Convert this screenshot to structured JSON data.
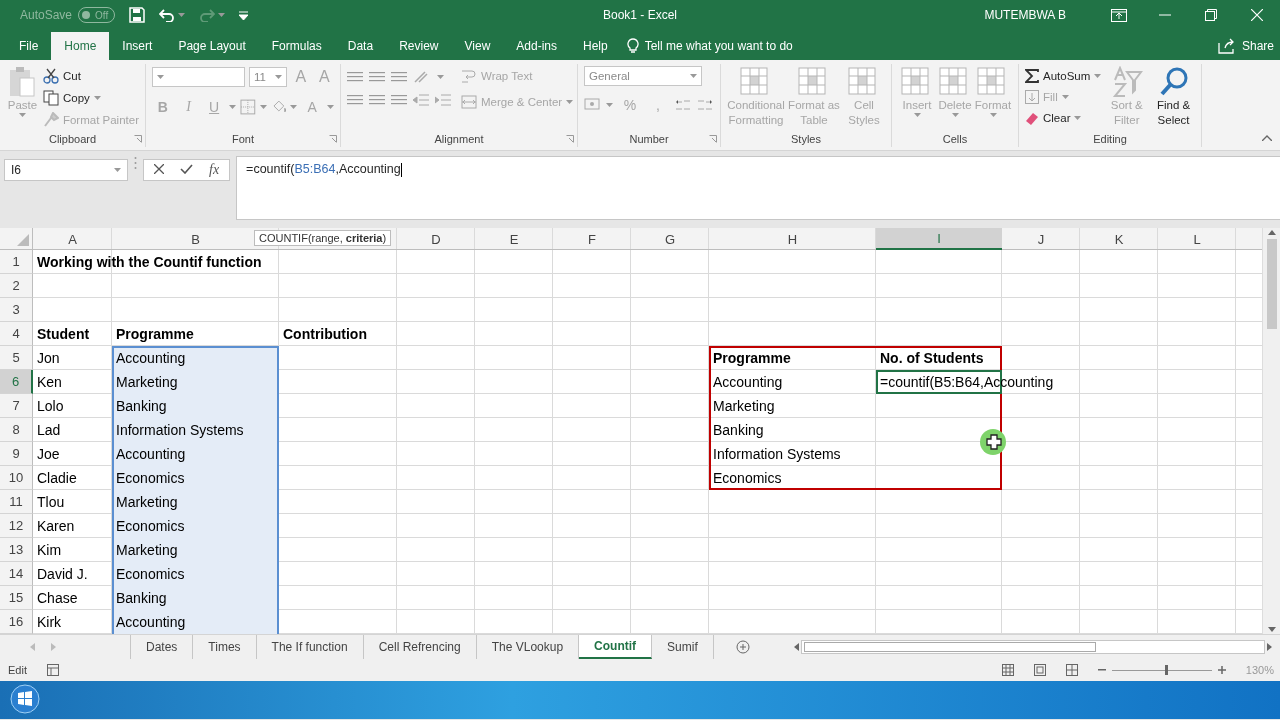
{
  "title_bar": {
    "autosave": {
      "label": "AutoSave",
      "toggle": "Off",
      "on": false
    },
    "title": "Book1  -  Excel",
    "user": "MUTEMBWA B"
  },
  "tabs": [
    {
      "label": "File",
      "selected": false
    },
    {
      "label": "Home",
      "selected": true
    },
    {
      "label": "Insert",
      "selected": false
    },
    {
      "label": "Page Layout",
      "selected": false
    },
    {
      "label": "Formulas",
      "selected": false
    },
    {
      "label": "Data",
      "selected": false
    },
    {
      "label": "Review",
      "selected": false
    },
    {
      "label": "View",
      "selected": false
    },
    {
      "label": "Add-ins",
      "selected": false
    },
    {
      "label": "Help",
      "selected": false
    }
  ],
  "tell_me": "Tell me what you want to do",
  "share": "Share",
  "ribbon": {
    "clipboard": {
      "label": "Clipboard",
      "paste": {
        "label": "Paste",
        "disabled": true
      },
      "cut": {
        "label": "Cut",
        "disabled": false
      },
      "copy": {
        "label": "Copy",
        "disabled": false
      },
      "format_painter": {
        "label": "Format Painter",
        "disabled": true
      }
    },
    "font": {
      "label": "Font",
      "size": "11",
      "buttons": [
        {
          "label": "A",
          "kind": "grow"
        },
        {
          "label": "A",
          "kind": "shrink"
        },
        {
          "label": "B",
          "kind": "bold"
        },
        {
          "label": "I",
          "kind": "italic"
        },
        {
          "label": "U",
          "kind": "underline"
        },
        {
          "label": "A",
          "kind": "color"
        }
      ]
    },
    "alignment": {
      "label": "Alignment",
      "wrap_text": {
        "label": "Wrap Text",
        "disabled": true
      },
      "merge": {
        "label": "Merge & Center",
        "disabled": true
      }
    },
    "number": {
      "label": "Number",
      "format": "General",
      "symbols": [
        "%",
        ","
      ]
    },
    "styles": {
      "label": "Styles",
      "buttons": [
        {
          "label": "Conditional Formatting",
          "disabled": true
        },
        {
          "label": "Format as Table",
          "disabled": true
        },
        {
          "label": "Cell Styles",
          "disabled": true
        }
      ]
    },
    "cells": {
      "label": "Cells",
      "buttons": [
        {
          "label": "Insert",
          "disabled": true
        },
        {
          "label": "Delete",
          "disabled": true
        },
        {
          "label": "Format",
          "disabled": true
        }
      ]
    },
    "editing": {
      "label": "Editing",
      "small": [
        {
          "label": "AutoSum",
          "disabled": false
        },
        {
          "label": "Fill",
          "disabled": true
        },
        {
          "label": "Clear",
          "disabled": false
        }
      ],
      "big": [
        {
          "label": "Sort & Filter",
          "disabled": true
        },
        {
          "label": "Find & Select",
          "disabled": false
        }
      ]
    }
  },
  "formula_bar": {
    "name_box": "I6",
    "fx": "fx",
    "formula": {
      "start": "=countif(",
      "reference": "B5:B64",
      "end": ",Accounting"
    }
  },
  "sheet": {
    "columns": [
      {
        "label": "A",
        "selected": false
      },
      {
        "label": "B",
        "selected": false
      },
      {
        "selected": false
      },
      {
        "label": "D",
        "selected": false
      },
      {
        "label": "E",
        "selected": false
      },
      {
        "label": "F",
        "selected": false
      },
      {
        "label": "G",
        "selected": false
      },
      {
        "label": "H",
        "selected": false
      },
      {
        "label": "I",
        "selected": true
      },
      {
        "label": "J",
        "selected": false
      },
      {
        "label": "K",
        "selected": false
      },
      {
        "label": "L",
        "selected": false
      }
    ],
    "rows": [
      {
        "label": "1",
        "selected": false
      },
      {
        "label": "2",
        "selected": false
      },
      {
        "label": "3",
        "selected": false
      },
      {
        "label": "4",
        "selected": false
      },
      {
        "label": "5",
        "selected": false
      },
      {
        "label": "6",
        "selected": true
      },
      {
        "label": "7",
        "selected": false
      },
      {
        "label": "8",
        "selected": false
      },
      {
        "label": "9",
        "selected": false
      },
      {
        "label": "10",
        "selected": false
      },
      {
        "label": "11",
        "selected": false
      },
      {
        "label": "12",
        "selected": false
      },
      {
        "label": "13",
        "selected": false
      },
      {
        "label": "14",
        "selected": false
      },
      {
        "label": "15",
        "selected": false
      },
      {
        "label": "16",
        "selected": false
      }
    ],
    "tooltip": "COUNTIF(range, **criteria**)",
    "title": "Working with the Countif function",
    "students": {
      "headers": [
        "Student",
        "Programme",
        "Contribution"
      ],
      "rows": [
        {
          "student": "Jon",
          "programme": "Accounting",
          "highlighted": true
        },
        {
          "student": "Ken",
          "programme": "Marketing",
          "highlighted": true
        },
        {
          "student": "Lolo",
          "programme": "Banking",
          "highlighted": true
        },
        {
          "student": "Lad",
          "programme": "Information Systems",
          "highlighted": true
        },
        {
          "student": "Joe",
          "programme": "Accounting",
          "highlighted": true
        },
        {
          "student": "Cladie",
          "programme": "Economics",
          "highlighted": true
        },
        {
          "student": "Tlou",
          "programme": "Marketing",
          "highlighted": true
        },
        {
          "student": "Karen",
          "programme": "Economics",
          "highlighted": true
        },
        {
          "student": "Kim",
          "programme": "Marketing",
          "highlighted": true
        },
        {
          "student": "David J.",
          "programme": "Economics",
          "highlighted": true
        },
        {
          "student": "Chase",
          "programme": "Banking",
          "highlighted": true
        },
        {
          "student": "Kirk",
          "programme": "Accounting",
          "highlighted": true
        }
      ]
    },
    "summary": {
      "headers": [
        "Programme",
        "No. of Students"
      ],
      "rows": [
        {
          "programme": "Accounting",
          "count": "=countif(B5:B64,Accounting",
          "active": true
        },
        {
          "programme": "Marketing",
          "active": false
        },
        {
          "programme": "Banking",
          "active": false
        },
        {
          "programme": "Information Systems",
          "active": false
        },
        {
          "programme": "Economics",
          "active": false
        }
      ]
    }
  },
  "sheet_tabs": [
    {
      "label": "Dates",
      "selected": false
    },
    {
      "label": "Times",
      "selected": false
    },
    {
      "label": "The If function",
      "selected": false
    },
    {
      "label": "Cell Refrencing",
      "selected": false
    },
    {
      "label": "The VLookup",
      "selected": false
    },
    {
      "label": "Countif",
      "selected": true
    },
    {
      "label": "Sumif",
      "selected": false
    }
  ],
  "status_bar": {
    "mode": "Edit",
    "zoom": {
      "level": 0.55,
      "reading": "130%"
    }
  }
}
